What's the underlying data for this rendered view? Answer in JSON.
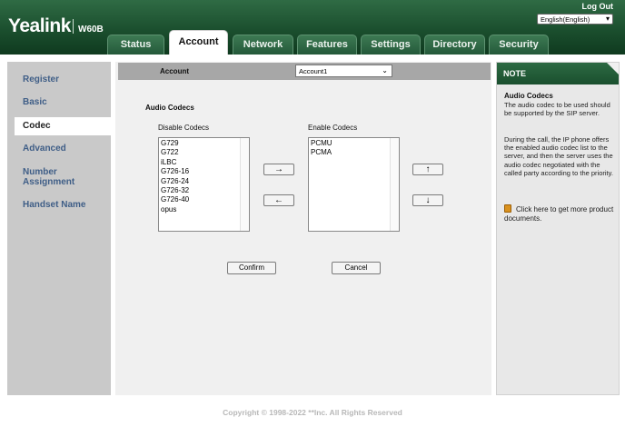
{
  "header": {
    "logo": "Yealink",
    "model": "W60B",
    "logout": "Log Out",
    "language": "English(English)",
    "tabs": [
      {
        "label": "Status",
        "active": false
      },
      {
        "label": "Account",
        "active": true
      },
      {
        "label": "Network",
        "active": false
      },
      {
        "label": "Features",
        "active": false
      },
      {
        "label": "Settings",
        "active": false
      },
      {
        "label": "Directory",
        "active": false
      },
      {
        "label": "Security",
        "active": false
      }
    ]
  },
  "sidebar": {
    "items": [
      {
        "label": "Register",
        "active": false
      },
      {
        "label": "Basic",
        "active": false
      },
      {
        "label": "Codec",
        "active": true
      },
      {
        "label": "Advanced",
        "active": false
      },
      {
        "label": "Number Assignment",
        "active": false
      },
      {
        "label": "Handset Name",
        "active": false
      }
    ]
  },
  "main": {
    "account_label": "Account",
    "account_value": "Account1",
    "section_title": "Audio Codecs",
    "disable_label": "Disable Codecs",
    "enable_label": "Enable Codecs",
    "disabled_codecs": [
      "G729",
      "G722",
      "iLBC",
      "G726-16",
      "G726-24",
      "G726-32",
      "G726-40",
      "opus"
    ],
    "enabled_codecs": [
      "PCMU",
      "PCMA"
    ],
    "move_right": "→",
    "move_left": "←",
    "move_up": "↑",
    "move_down": "↓",
    "confirm": "Confirm",
    "cancel": "Cancel"
  },
  "note": {
    "title": "NOTE",
    "subtitle": "Audio Codecs",
    "para1": "The audio codec to be used should be supported by the SIP server.",
    "para2": "During the call, the IP phone offers the enabled audio codec list to the server, and then the server uses the audio codec negotiated with the called party according to the priority.",
    "link": "Click here to get more product documents."
  },
  "footer": "Copyright © 1998-2022 **Inc. All Rights Reserved",
  "colors": {
    "header_green": "#1b4f2e",
    "sidebar_gray": "#c9c9c9",
    "sidebar_link": "#3f5e87",
    "panel_bg": "#f0f0f0"
  }
}
